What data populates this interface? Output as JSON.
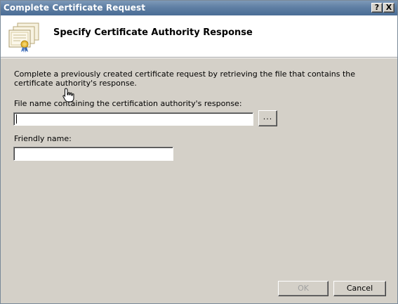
{
  "window": {
    "title": "Complete Certificate Request",
    "help_button": "?",
    "close_button": "X"
  },
  "header": {
    "title": "Specify Certificate Authority Response",
    "icon": "certificate-icon"
  },
  "body": {
    "description": "Complete a previously created certificate request by retrieving the file that contains the certificate authority's response.",
    "file_label": "File name containing the certification authority's response:",
    "file_value": "",
    "browse_label": "...",
    "friendly_label": "Friendly name:",
    "friendly_value": ""
  },
  "footer": {
    "ok_label": "OK",
    "ok_enabled": false,
    "cancel_label": "Cancel"
  },
  "colors": {
    "titlebar": "#5f7fa4",
    "dialog_background": "#d4d0c8",
    "header_background": "#ffffff",
    "disabled_text": "#a0a0a0"
  }
}
